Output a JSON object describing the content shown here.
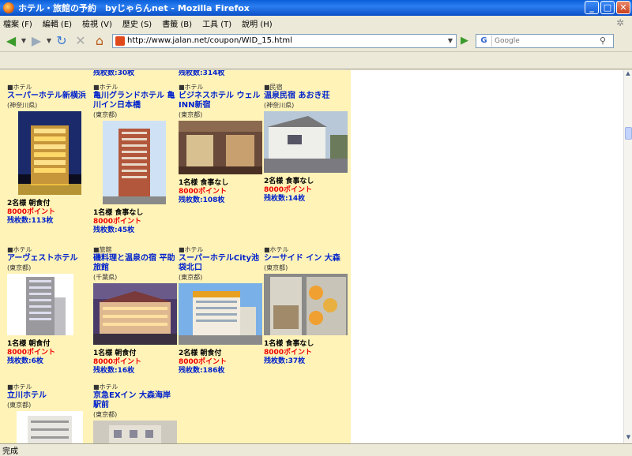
{
  "window": {
    "title": "ホテル・旅館の予約　byじゃらんnet - Mozilla Firefox",
    "btn_min": "_",
    "btn_max": "□",
    "btn_close": "✕"
  },
  "menu": [
    "檔案 (F)",
    "編輯 (E)",
    "檢視 (V)",
    "歷史 (S)",
    "書籤 (B)",
    "工具 (T)",
    "說明 (H)"
  ],
  "nav": {
    "url": "http://www.jalan.net/coupon/WID_15.html",
    "search_placeholder": "Google",
    "search_engine": "G"
  },
  "top_partial": [
    {
      "text": "残枚数:30枚"
    },
    {
      "text": "残枚数:314枚"
    }
  ],
  "hotels": [
    {
      "category": "■ホテル",
      "name": "スーパーホテル新横浜",
      "region": "(神奈川県)",
      "room": "2名様 朝食付",
      "points": "8000ポイント",
      "remaining": "残枚数:113枚"
    },
    {
      "category": "■ホテル",
      "name": "亀川グランドホテル 亀川イン日本橋",
      "region": "(東京都)",
      "room": "1名様 食事なし",
      "points": "8000ポイント",
      "remaining": "残枚数:45枚"
    },
    {
      "category": "■ホテル",
      "name": "ビジネスホテル ウェル INN新宿",
      "region": "(東京都)",
      "room": "1名様 食事なし",
      "points": "8000ポイント",
      "remaining": "残枚数:108枚"
    },
    {
      "category": "■民宿",
      "name": "温泉民宿 あおき荘",
      "region": "(神奈川県)",
      "room": "2名様 食事なし",
      "points": "8000ポイント",
      "remaining": "残枚数:14枚"
    },
    {
      "category": "■ホテル",
      "name": "アーヴェストホテル",
      "region": "(東京都)",
      "room": "1名様 朝食付",
      "points": "8000ポイント",
      "remaining": "残枚数:6枚"
    },
    {
      "category": "■旅館",
      "name": "磯料理と温泉の宿 平助旅館",
      "region": "(千葉県)",
      "room": "1名様 朝食付",
      "points": "8000ポイント",
      "remaining": "残枚数:16枚"
    },
    {
      "category": "■ホテル",
      "name": "スーパーホテルCity池袋北口",
      "region": "(東京都)",
      "room": "2名様 朝食付",
      "points": "8000ポイント",
      "remaining": "残枚数:186枚"
    },
    {
      "category": "■ホテル",
      "name": "シーサイド イン 大森",
      "region": "(東京都)",
      "room": "1名様 食事なし",
      "points": "8000ポイント",
      "remaining": "残枚数:37枚"
    },
    {
      "category": "■ホテル",
      "name": "立川ホテル",
      "region": "(東京都)"
    },
    {
      "category": "■ホテル",
      "name": "京急EXイン 大森海岸駅前",
      "region": "(東京都)"
    }
  ],
  "status": "完成"
}
